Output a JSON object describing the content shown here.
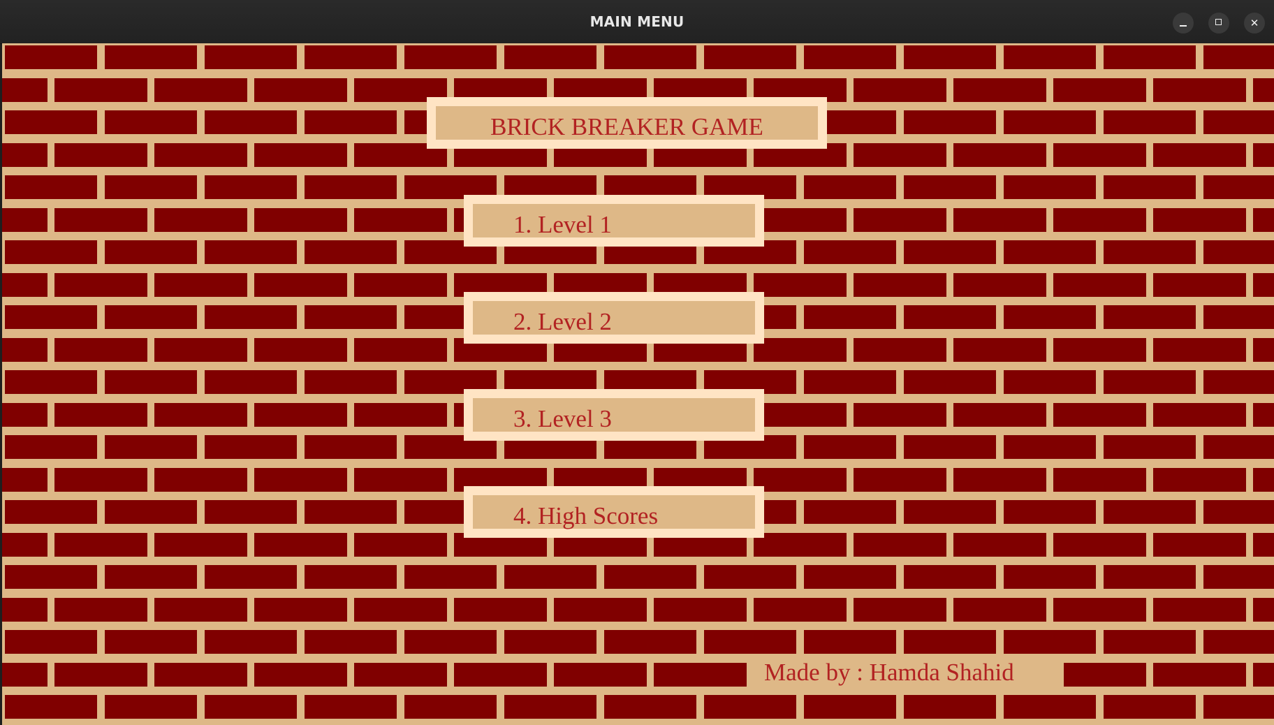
{
  "window": {
    "title": "MAIN MENU",
    "controls": {
      "minimize": "minimize-icon",
      "maximize": "maximize-icon",
      "close": "close-icon"
    }
  },
  "game": {
    "title": "BRICK BREAKER GAME",
    "menu": [
      {
        "label": "1. Level 1"
      },
      {
        "label": "2. Level 2"
      },
      {
        "label": "3. Level 3"
      },
      {
        "label": "4. High Scores"
      }
    ],
    "credit": "Made by : Hamda Shahid"
  },
  "colors": {
    "brick": "#800000",
    "mortar": "#deb887",
    "panel_border": "#ffe4c4",
    "text": "#b22222"
  }
}
